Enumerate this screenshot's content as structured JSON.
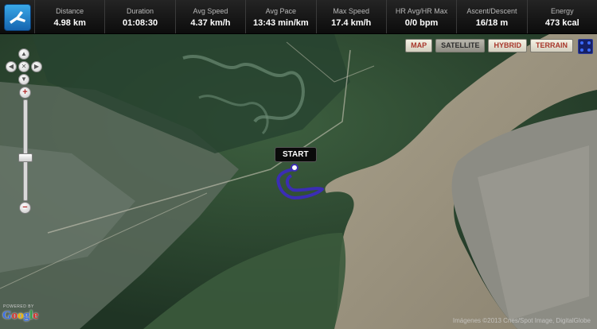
{
  "app": {
    "logo_icon": "runner-icon"
  },
  "stats": [
    {
      "label": "Distance",
      "value": "4.98 km"
    },
    {
      "label": "Duration",
      "value": "01:08:30"
    },
    {
      "label": "Avg Speed",
      "value": "4.37 km/h"
    },
    {
      "label": "Avg Pace",
      "value": "13:43 min/km"
    },
    {
      "label": "Max Speed",
      "value": "17.4 km/h"
    },
    {
      "label": "HR Avg/HR Max",
      "value": "0/0 bpm"
    },
    {
      "label": "Ascent/Descent",
      "value": "16/18 m"
    },
    {
      "label": "Energy",
      "value": "473 kcal"
    }
  ],
  "map": {
    "types": [
      "MAP",
      "SATELLITE",
      "HYBRID",
      "TERRAIN"
    ],
    "selected_type": "SATELLITE",
    "start_label": "START",
    "powered_by": "POWERED BY",
    "google_letters": [
      "G",
      "o",
      "o",
      "g",
      "l",
      "e"
    ],
    "google_colors": [
      "#3b6ee8",
      "#d8302c",
      "#f0b400",
      "#3b6ee8",
      "#2e9c45",
      "#d8302c"
    ],
    "copyright": "Imágenes ©2013 Cnes/Spot Image, DigitalGlobe",
    "track_color": "#3b2db4",
    "zoom_level_fraction": 0.58
  }
}
